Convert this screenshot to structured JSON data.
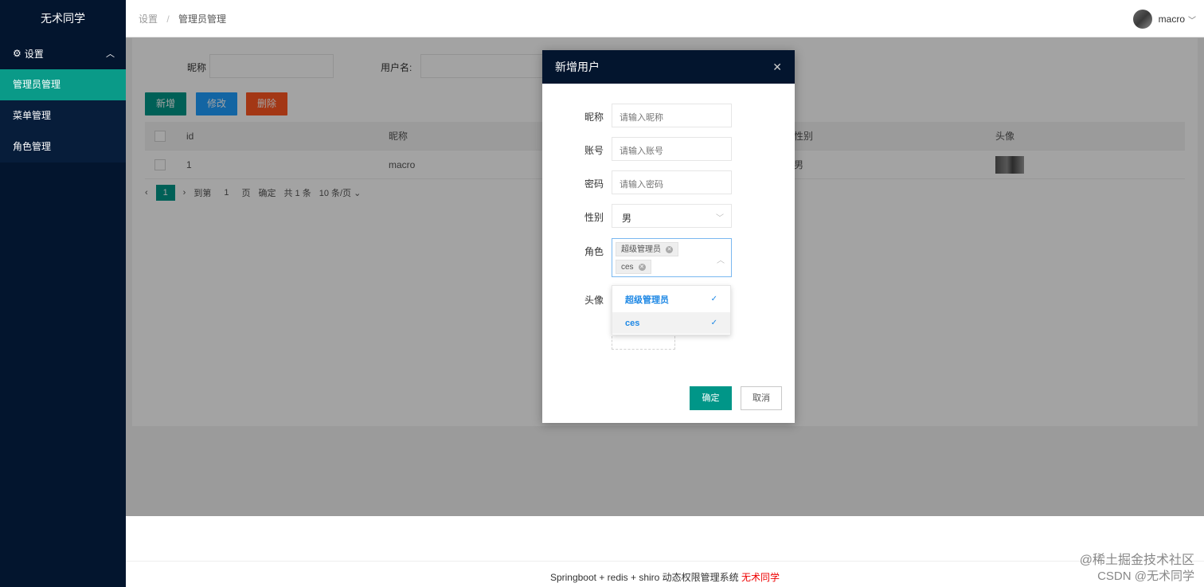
{
  "sidebar": {
    "brand": "无术同学",
    "group": {
      "icon": "gear-icon",
      "label": "设置"
    },
    "items": [
      {
        "label": "管理员管理",
        "active": true
      },
      {
        "label": "菜单管理",
        "active": false
      },
      {
        "label": "角色管理",
        "active": false
      }
    ]
  },
  "header": {
    "breadcrumb": [
      "设置",
      "管理员管理"
    ],
    "separator": "/",
    "user": {
      "name": "macro"
    }
  },
  "search": {
    "nickname_label": "昵称",
    "username_label": "用户名:"
  },
  "toolbar": {
    "add": "新增",
    "edit": "修改",
    "delete": "删除"
  },
  "table": {
    "columns": {
      "id": "id",
      "nickname": "昵称",
      "gender": "性别",
      "avatar": "头像"
    },
    "rows": [
      {
        "id": "1",
        "nickname": "macro",
        "gender": "男"
      }
    ]
  },
  "pager": {
    "current": "1",
    "goto_label": "到第",
    "goto_value": "1",
    "page_unit": "页",
    "confirm": "确定",
    "total": "共 1 条",
    "page_size": "10 条/页"
  },
  "dialog": {
    "title": "新增用户",
    "fields": {
      "nickname": {
        "label": "昵称",
        "placeholder": "请输入昵称"
      },
      "account": {
        "label": "账号",
        "placeholder": "请输入账号"
      },
      "password": {
        "label": "密码",
        "placeholder": "请输入密码"
      },
      "gender": {
        "label": "性别",
        "value": "男"
      },
      "roles": {
        "label": "角色",
        "selected": [
          "超级管理员",
          "ces"
        ]
      },
      "avatar": {
        "label": "头像"
      }
    },
    "role_options": [
      "超级管理员",
      "ces"
    ],
    "ok": "确定",
    "cancel": "取消"
  },
  "footer": {
    "text": "Springboot + redis + shiro 动态权限管理系统",
    "author": "无术同学"
  },
  "watermark": {
    "line1": "@稀土掘金技术社区",
    "line2": "CSDN @无术同学"
  },
  "colors": {
    "primary": "#009688",
    "blue": "#1e9fff",
    "danger": "#ff5722",
    "sidebar": "#03152e"
  }
}
